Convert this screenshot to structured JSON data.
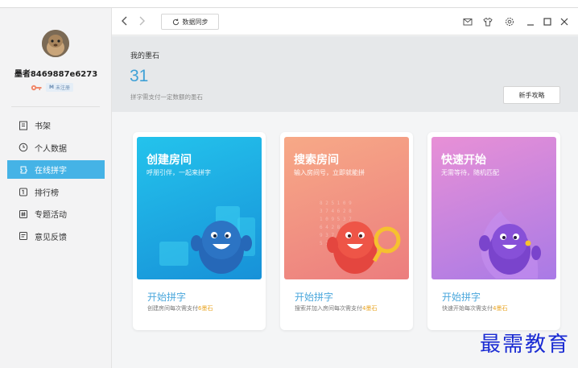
{
  "user": {
    "name": "墨者8469887e6273",
    "register_label": "未注册"
  },
  "nav": {
    "items": [
      {
        "label": "书架",
        "icon": "bookshelf-icon"
      },
      {
        "label": "个人数据",
        "icon": "clock-icon"
      },
      {
        "label": "在线拼字",
        "icon": "puzzle-icon",
        "active": true
      },
      {
        "label": "排行榜",
        "icon": "ranking-icon"
      },
      {
        "label": "专题活动",
        "icon": "hash-icon"
      },
      {
        "label": "意见反馈",
        "icon": "feedback-icon"
      }
    ]
  },
  "toolbar": {
    "sync_label": "数据同步"
  },
  "stats": {
    "title": "我的墨石",
    "value": "31",
    "description": "拼字需支付一定数额的墨石",
    "guide_label": "新手攻略"
  },
  "cards": [
    {
      "title": "创建房间",
      "subtitle": "呼朋引伴，一起来拼字",
      "action": "开始拼字",
      "note_prefix": "创建房间每次需支付",
      "price": "6墨石",
      "gradient": [
        "#1ec0ea",
        "#1a8fd8"
      ]
    },
    {
      "title": "搜索房间",
      "subtitle": "输入房间号，立即就能拼",
      "action": "开始拼字",
      "note_prefix": "搜索并加入房间每次需支付",
      "price": "4墨石",
      "gradient": [
        "#f6a383",
        "#ec7f7f"
      ]
    },
    {
      "title": "快速开始",
      "subtitle": "无需等待，随机匹配",
      "action": "开始拼字",
      "note_prefix": "快速开始每次需支付",
      "price": "4墨石",
      "gradient": [
        "#e48ed6",
        "#a879e6"
      ]
    }
  ],
  "watermark": "最需教育",
  "colors": {
    "accent": "#45b3e6",
    "price": "#e8a31e",
    "stat_value": "#3fa1d6"
  }
}
